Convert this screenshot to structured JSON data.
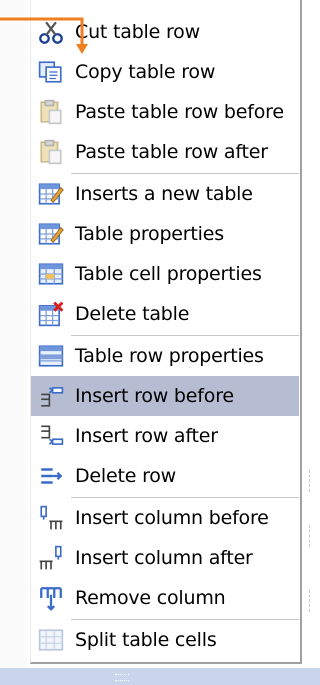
{
  "menu": {
    "items": [
      {
        "label": "Cut table row",
        "icon": "cut-icon"
      },
      {
        "label": "Copy table row",
        "icon": "copy-icon"
      },
      {
        "label": "Paste table row before",
        "icon": "paste-icon",
        "disabled": true
      },
      {
        "label": "Paste table row after",
        "icon": "paste-icon",
        "disabled": true
      },
      {
        "label": "Inserts a new table",
        "icon": "insert-table-icon"
      },
      {
        "label": "Table properties",
        "icon": "table-properties-icon"
      },
      {
        "label": "Table cell properties",
        "icon": "cell-properties-icon"
      },
      {
        "label": "Delete table",
        "icon": "delete-table-icon"
      },
      {
        "label": "Table row properties",
        "icon": "row-properties-icon"
      },
      {
        "label": "Insert row before",
        "icon": "insert-row-before-icon",
        "highlighted": true
      },
      {
        "label": "Insert row after",
        "icon": "insert-row-after-icon"
      },
      {
        "label": "Delete row",
        "icon": "delete-row-icon"
      },
      {
        "label": "Insert column before",
        "icon": "insert-column-before-icon"
      },
      {
        "label": "Insert column after",
        "icon": "insert-column-after-icon"
      },
      {
        "label": "Remove column",
        "icon": "remove-column-icon"
      },
      {
        "label": "Split table cells",
        "icon": "split-cells-icon",
        "disabled": true
      }
    ]
  },
  "colors": {
    "highlight": "#b6bdd2",
    "annotation_arrow": "#f07d1e"
  }
}
